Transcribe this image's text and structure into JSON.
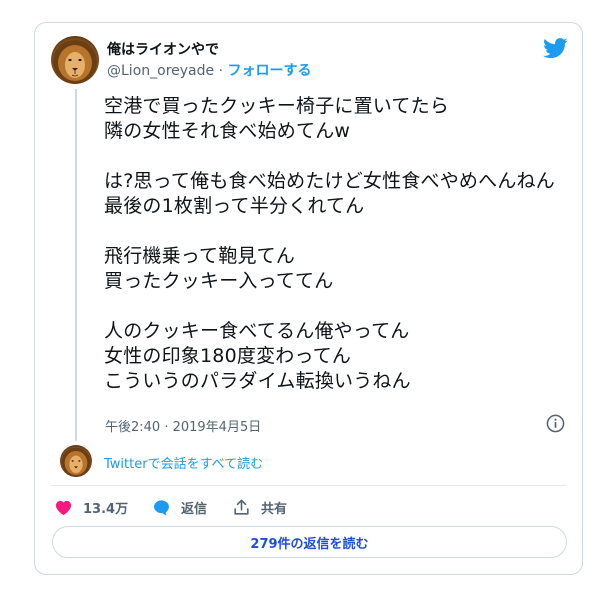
{
  "author": {
    "display_name": "俺はライオンやで",
    "handle": "@Lion_oreyade",
    "separator": " · ",
    "follow_label": "フォローする"
  },
  "tweet": {
    "text": "空港で買ったクッキー椅子に置いてたら\n隣の女性それ食べ始めてんw\n\nは?思って俺も食べ始めたけど女性食べやめへんねん\n最後の1枚割って半分くれてん\n\n飛行機乗って鞄見てん\n買ったクッキー入っててん\n\n人のクッキー食べてるん俺やってん\n女性の印象180度変わってん\nこういうのパラダイム転換いうねん",
    "timestamp": "午後2:40 · 2019年4月5日"
  },
  "conversation": {
    "link_label": "Twitterで会話をすべて読む"
  },
  "actions": {
    "like_count": "13.4万",
    "reply_label": "返信",
    "share_label": "共有"
  },
  "replies_button": {
    "label": "279件の返信を読む"
  },
  "colors": {
    "accent": "#1d9bf0",
    "like": "#f91880",
    "border": "#cfd9de",
    "secondary_text": "#536471"
  },
  "icons": [
    "twitter-bird-icon",
    "info-icon",
    "heart-icon",
    "reply-bubble-icon",
    "share-icon"
  ]
}
